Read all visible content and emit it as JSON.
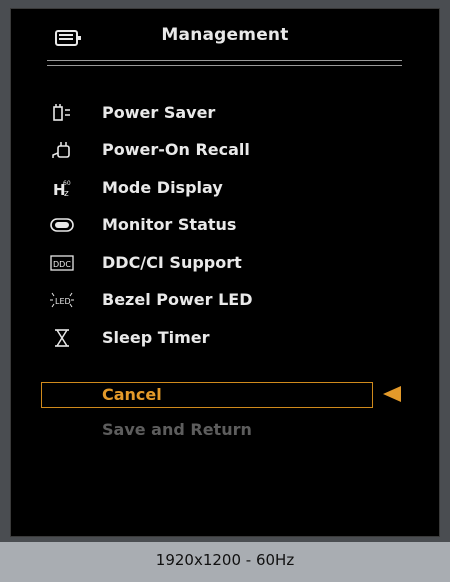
{
  "osd": {
    "title": "Management",
    "title_icon": "management-icon",
    "items": [
      {
        "label": "Power Saver",
        "icon": "power-saver-icon"
      },
      {
        "label": "Power-On Recall",
        "icon": "power-on-recall-icon"
      },
      {
        "label": "Mode Display",
        "icon": "mode-display-icon"
      },
      {
        "label": "Monitor Status",
        "icon": "monitor-status-icon"
      },
      {
        "label": "DDC/CI Support",
        "icon": "ddc-ci-icon"
      },
      {
        "label": "Bezel Power LED",
        "icon": "bezel-led-icon"
      },
      {
        "label": "Sleep Timer",
        "icon": "sleep-timer-icon"
      }
    ],
    "cancel_label": "Cancel",
    "save_label": "Save and Return",
    "selected": "Cancel"
  },
  "status": {
    "resolution": "1920x1200 - 60Hz"
  },
  "colors": {
    "highlight": "#e49a2a",
    "text": "#e9e9e9",
    "disabled": "#5d5d5d",
    "osd_background": "#000000"
  }
}
